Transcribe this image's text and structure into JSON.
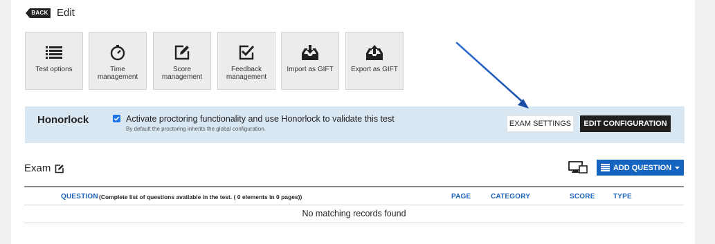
{
  "header": {
    "back_label": "BACK",
    "title": "Edit"
  },
  "tools": [
    {
      "label_lines": [
        "Test options"
      ],
      "icon": "list-icon"
    },
    {
      "label_lines": [
        "Time",
        "management"
      ],
      "icon": "stopwatch-icon"
    },
    {
      "label_lines": [
        "Score",
        "management"
      ],
      "icon": "edit-square-icon"
    },
    {
      "label_lines": [
        "Feedback",
        "management"
      ],
      "icon": "checkbox-icon"
    },
    {
      "label_lines": [
        "Import as GIFT"
      ],
      "icon": "inbox-down-icon"
    },
    {
      "label_lines": [
        "Export as GIFT"
      ],
      "icon": "inbox-up-icon"
    }
  ],
  "honorlock": {
    "title": "Honorlock",
    "checkbox_checked": true,
    "activate_text": "Activate proctoring functionality and use Honorlock to validate this test",
    "sub_text": "By default the proctoring inherits the global configuration.",
    "exam_settings_label": "EXAM SETTINGS",
    "edit_configuration_label": "EDIT CONFIGURATION",
    "band_color": "#d9e7f3"
  },
  "exam": {
    "title": "Exam",
    "add_question_label": "ADD QUESTION",
    "accent_color": "#1565c0"
  },
  "table": {
    "col_question": "QUESTION",
    "question_note": "(Complete list of questions available in the test. ( 0 elements in 0 pages))",
    "col_page": "PAGE",
    "col_category": "CATEGORY",
    "col_score": "SCORE",
    "col_type": "TYPE",
    "empty_message": "No matching records found"
  }
}
